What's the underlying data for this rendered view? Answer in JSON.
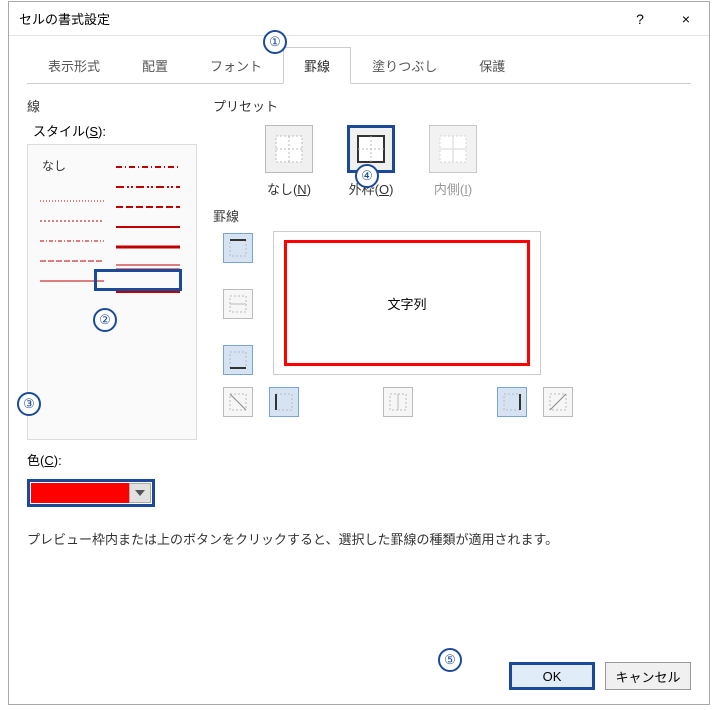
{
  "dialog": {
    "title": "セルの書式設定"
  },
  "titlebar": {
    "help": "?",
    "close": "×"
  },
  "tabs": [
    "表示形式",
    "配置",
    "フォント",
    "罫線",
    "塗りつぶし",
    "保護"
  ],
  "active_tab_index": 3,
  "line": {
    "section": "線",
    "style_label": "スタイル(S):",
    "none": "なし"
  },
  "color": {
    "label": "色(C):",
    "value": "#ff0000"
  },
  "preset": {
    "section": "プリセット",
    "items": [
      {
        "key": "none",
        "label": "なし(N)"
      },
      {
        "key": "outline",
        "label": "外枠(O)"
      },
      {
        "key": "inside",
        "label": "内側(I)"
      }
    ],
    "selected": "outline"
  },
  "border": {
    "section": "罫線",
    "preview_text": "文字列"
  },
  "hint": "プレビュー枠内または上のボタンをクリックすると、選択した罫線の種類が適用されます。",
  "buttons": {
    "ok": "OK",
    "cancel": "キャンセル"
  },
  "callouts": {
    "c1": "①",
    "c2": "②",
    "c3": "③",
    "c4": "④",
    "c5": "⑤"
  }
}
